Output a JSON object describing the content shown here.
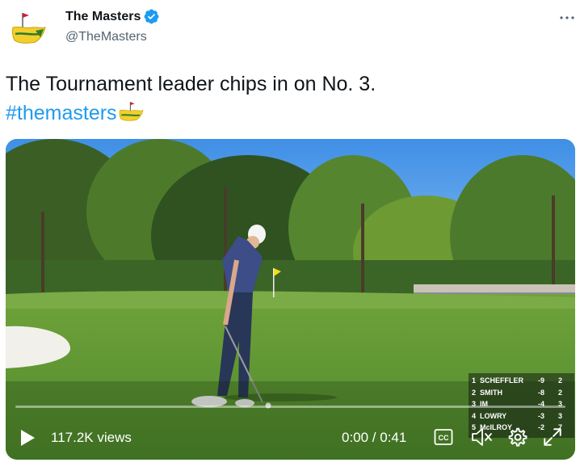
{
  "author": {
    "display_name": "The Masters",
    "handle": "@TheMasters",
    "avatar_icon": "masters-logo-icon",
    "verified_icon": "verified-badge-icon",
    "verified_color": "#1d9bf0"
  },
  "menu": {
    "icon": "more-options-icon"
  },
  "tweet": {
    "text": "The Tournament leader chips in on No. 3.",
    "hashtag": "#themasters",
    "hashtag_emoji_icon": "masters-logo-icon"
  },
  "video": {
    "views": "117.2K views",
    "time": "0:00 / 0:41",
    "progress": 0.0,
    "controls": {
      "play_icon": "play-icon",
      "cc_label": "CC",
      "volume_icon": "volume-muted-icon",
      "settings_icon": "gear-icon",
      "fullscreen_icon": "fullscreen-icon"
    },
    "leaderboard": [
      {
        "pos": "1",
        "name": "SCHEFFLER",
        "score": "-9",
        "thru": "2"
      },
      {
        "pos": "2",
        "name": "SMITH",
        "score": "-8",
        "thru": "2"
      },
      {
        "pos": "3",
        "name": "IM",
        "score": "-4",
        "thru": "3"
      },
      {
        "pos": "4",
        "name": "LOWRY",
        "score": "-3",
        "thru": "3"
      },
      {
        "pos": "5",
        "name": "McILROY",
        "score": "-2",
        "thru": "7"
      }
    ]
  },
  "colors": {
    "text_primary": "#0f1419",
    "text_secondary": "#536471",
    "link": "#1d9bf0"
  }
}
